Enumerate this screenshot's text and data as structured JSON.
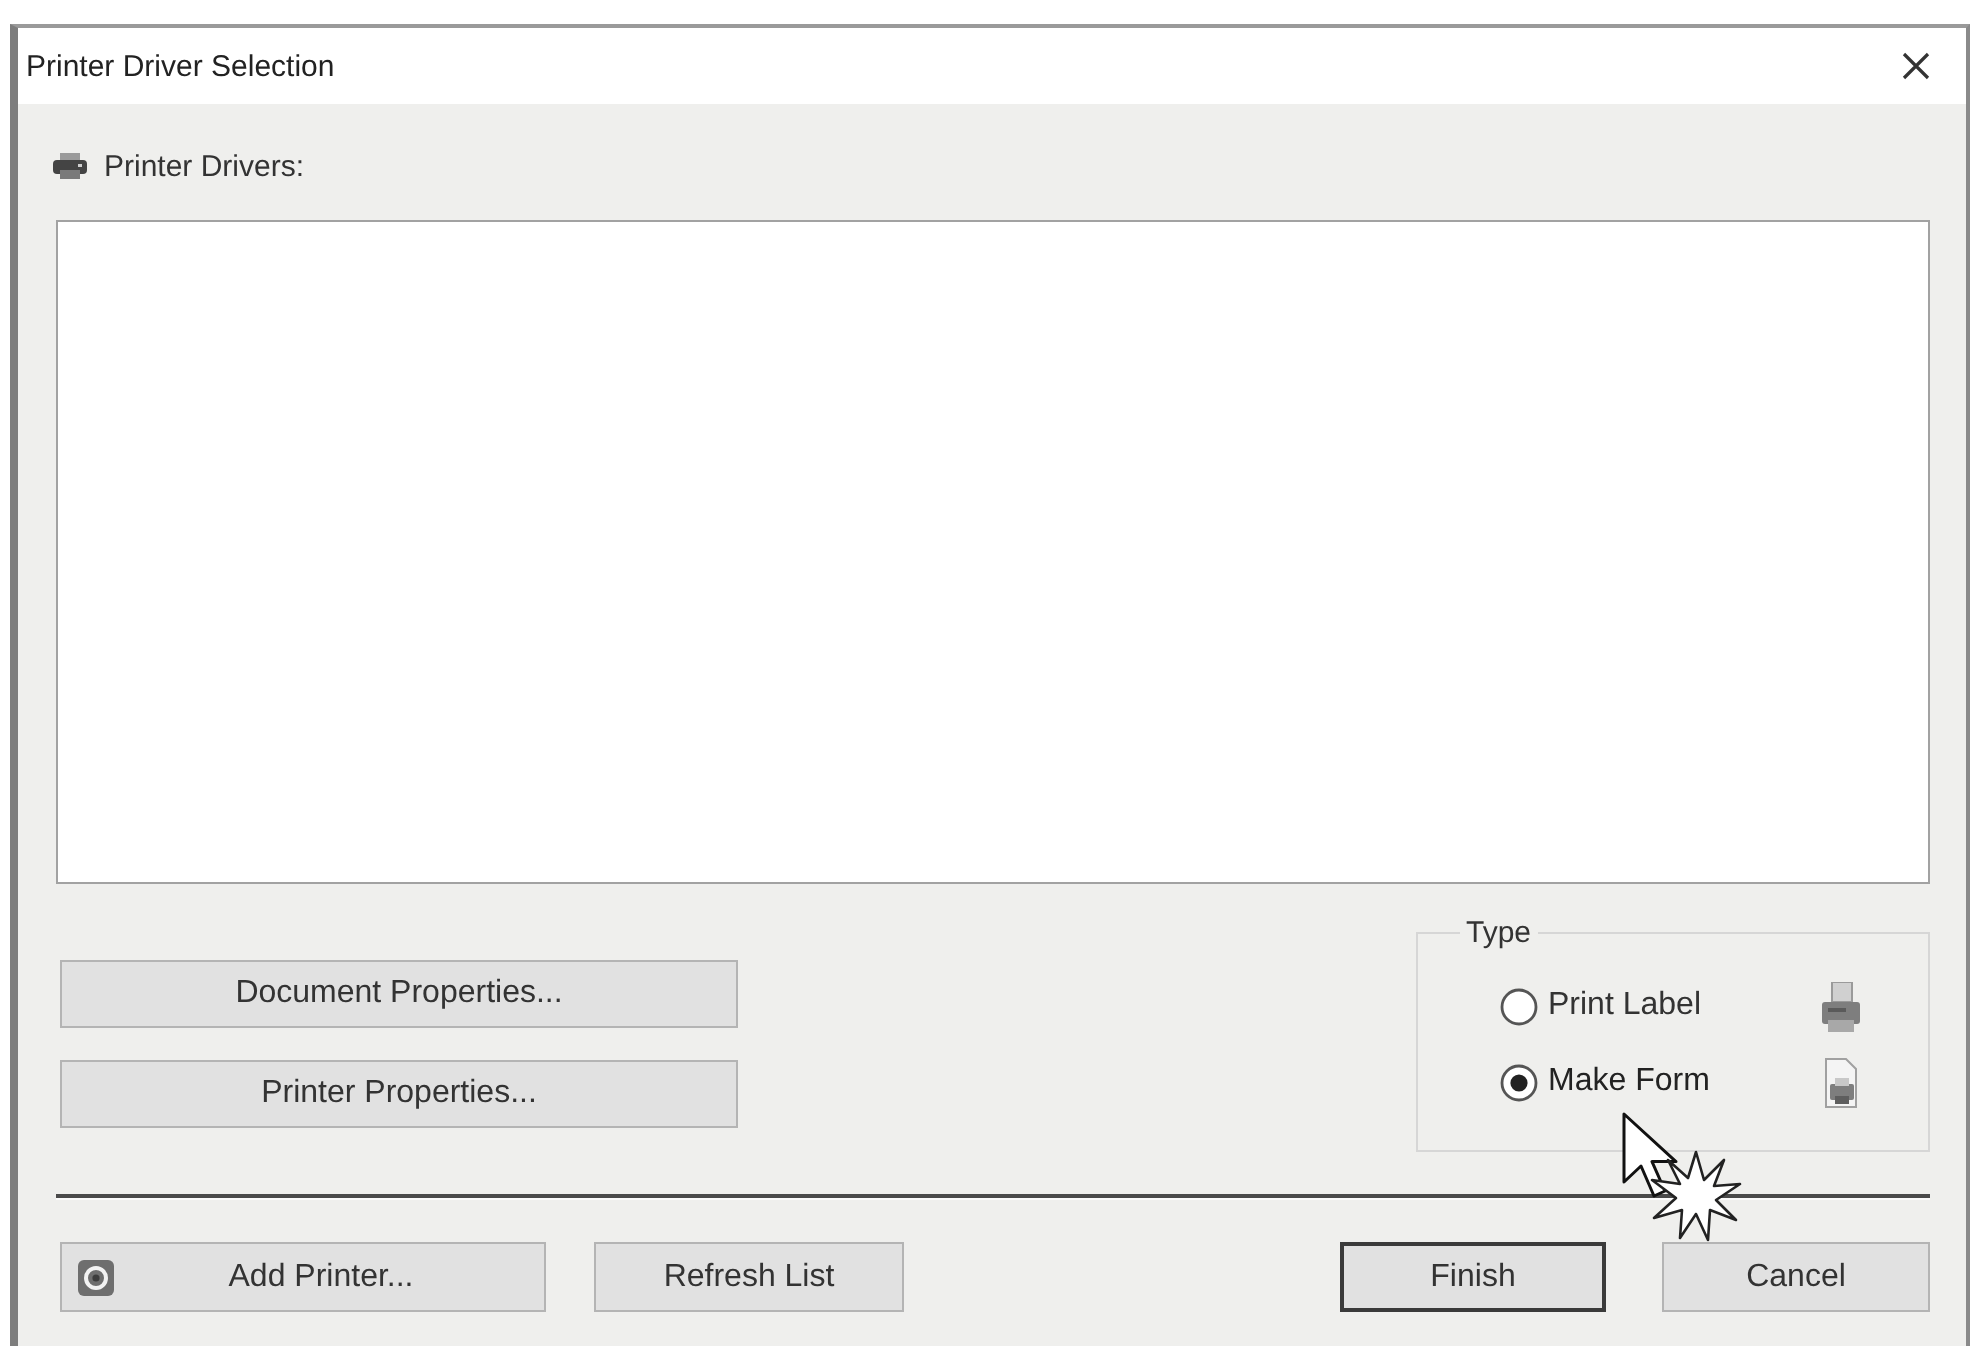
{
  "window": {
    "title": "Printer Driver Selection"
  },
  "drivers": {
    "label": "Printer Drivers:"
  },
  "property_buttons": [
    "Document Properties...",
    "Printer Properties..."
  ],
  "type_group": {
    "legend": "Type",
    "options": [
      {
        "label": "Print Label",
        "selected": false,
        "kind": "label"
      },
      {
        "label": "Make Form",
        "selected": true,
        "kind": "form"
      }
    ]
  },
  "left_buttons": [
    {
      "label": "Add Printer...",
      "kind": "icon"
    },
    {
      "label": "Refresh List",
      "kind": "plain"
    }
  ],
  "right_buttons": [
    {
      "label": "Finish",
      "kind": "default"
    },
    {
      "label": "Cancel",
      "kind": "plain"
    }
  ]
}
